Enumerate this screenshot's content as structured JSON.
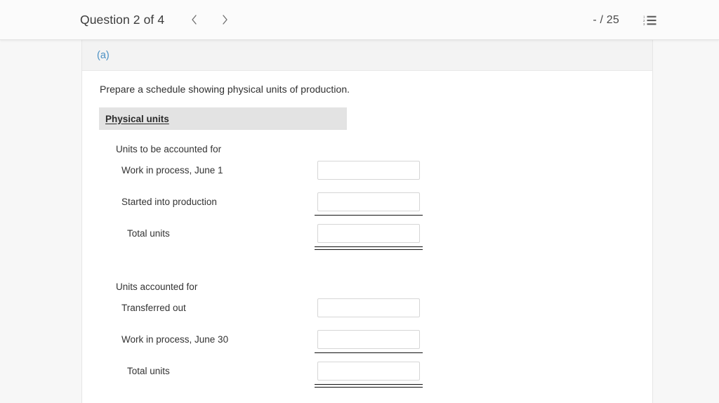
{
  "header": {
    "question_title": "Question 2 of 4",
    "prev_icon": "chevron-left-icon",
    "next_icon": "chevron-right-icon",
    "score": "- / 25",
    "list_icon": "numbered-list-icon"
  },
  "part": {
    "label": "(a)",
    "label_color": "#4a90c4"
  },
  "content": {
    "instruction": "Prepare a schedule showing physical units of production."
  },
  "schedule": {
    "column_header": "Physical units",
    "groups": [
      {
        "title": "Units to be accounted for",
        "rows": [
          {
            "label": "Work in process, June 1",
            "value": "",
            "rule": "none",
            "indent": "normal"
          },
          {
            "label": "Started into production",
            "value": "",
            "rule": "single",
            "indent": "normal"
          },
          {
            "label": "Total units",
            "value": "",
            "rule": "double",
            "indent": "total"
          }
        ]
      },
      {
        "title": "Units accounted for",
        "rows": [
          {
            "label": "Transferred out",
            "value": "",
            "rule": "none",
            "indent": "normal"
          },
          {
            "label": "Work in process, June 30",
            "value": "",
            "rule": "single",
            "indent": "normal"
          },
          {
            "label": "Total units",
            "value": "",
            "rule": "double",
            "indent": "total"
          }
        ]
      }
    ]
  }
}
